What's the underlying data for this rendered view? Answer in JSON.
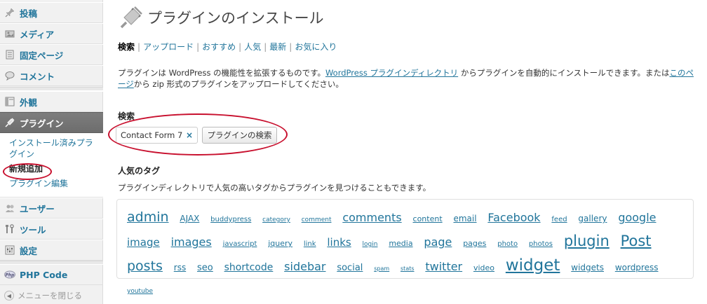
{
  "sidebar": {
    "items": [
      {
        "label": "投稿",
        "icon": "pin-icon"
      },
      {
        "label": "メディア",
        "icon": "media-icon"
      },
      {
        "label": "固定ページ",
        "icon": "page-icon"
      },
      {
        "label": "コメント",
        "icon": "comment-icon"
      },
      {
        "label": "外観",
        "icon": "appearance-icon"
      },
      {
        "label": "プラグイン",
        "icon": "plugin-icon"
      },
      {
        "label": "ユーザー",
        "icon": "users-icon"
      },
      {
        "label": "ツール",
        "icon": "tools-icon"
      },
      {
        "label": "設定",
        "icon": "settings-icon"
      },
      {
        "label": "PHP Code",
        "icon": "php-icon"
      }
    ],
    "submenu": {
      "installed": "インストール済みプラグイン",
      "add_new": "新規追加",
      "editor": "プラグイン編集"
    },
    "collapse_label": "メニューを閉じる"
  },
  "page": {
    "title": "プラグインのインストール",
    "tabs": [
      "検索",
      "アップロード",
      "おすすめ",
      "人気",
      "最新",
      "お気に入り"
    ],
    "desc": {
      "part1": "プラグインは WordPress の機能性を拡張するものです。",
      "link1": "WordPress プラグインディレクトリ",
      "part2": " からプラグインを自動的にインストールできます。または",
      "link2": "このページ",
      "part3": "から zip 形式のプラグインをアップロードしてください。"
    },
    "search": {
      "label": "検索",
      "value": "Contact Form 7",
      "clear": "×",
      "button": "プラグインの検索"
    },
    "popular_tags": {
      "label": "人気のタグ",
      "desc": "プラグインディレクトリで人気の高いタグからプラグインを見つけることもできます。",
      "tags": [
        {
          "name": "admin",
          "size": 19
        },
        {
          "name": "AJAX",
          "size": 12
        },
        {
          "name": "buddypress",
          "size": 10
        },
        {
          "name": "category",
          "size": 9
        },
        {
          "name": "comment",
          "size": 9
        },
        {
          "name": "comments",
          "size": 16
        },
        {
          "name": "content",
          "size": 11
        },
        {
          "name": "email",
          "size": 12
        },
        {
          "name": "Facebook",
          "size": 16
        },
        {
          "name": "feed",
          "size": 10
        },
        {
          "name": "gallery",
          "size": 12
        },
        {
          "name": "google",
          "size": 16
        },
        {
          "name": "image",
          "size": 15
        },
        {
          "name": "images",
          "size": 16
        },
        {
          "name": "javascript",
          "size": 10
        },
        {
          "name": "jquery",
          "size": 11
        },
        {
          "name": "link",
          "size": 10
        },
        {
          "name": "links",
          "size": 15
        },
        {
          "name": "login",
          "size": 9
        },
        {
          "name": "media",
          "size": 11
        },
        {
          "name": "page",
          "size": 16
        },
        {
          "name": "pages",
          "size": 11
        },
        {
          "name": "photo",
          "size": 10
        },
        {
          "name": "photos",
          "size": 10
        },
        {
          "name": "plugin",
          "size": 21
        },
        {
          "name": "Post",
          "size": 21
        },
        {
          "name": "posts",
          "size": 19
        },
        {
          "name": "rss",
          "size": 12
        },
        {
          "name": "seo",
          "size": 13
        },
        {
          "name": "shortcode",
          "size": 14
        },
        {
          "name": "sidebar",
          "size": 16
        },
        {
          "name": "social",
          "size": 13
        },
        {
          "name": "spam",
          "size": 8
        },
        {
          "name": "stats",
          "size": 8
        },
        {
          "name": "twitter",
          "size": 16
        },
        {
          "name": "video",
          "size": 11
        },
        {
          "name": "widget",
          "size": 23
        },
        {
          "name": "widgets",
          "size": 12
        },
        {
          "name": "wordpress",
          "size": 12
        },
        {
          "name": "youtube",
          "size": 9
        }
      ]
    }
  },
  "colors": {
    "link": "#21759b",
    "annotation": "#c8102e"
  }
}
